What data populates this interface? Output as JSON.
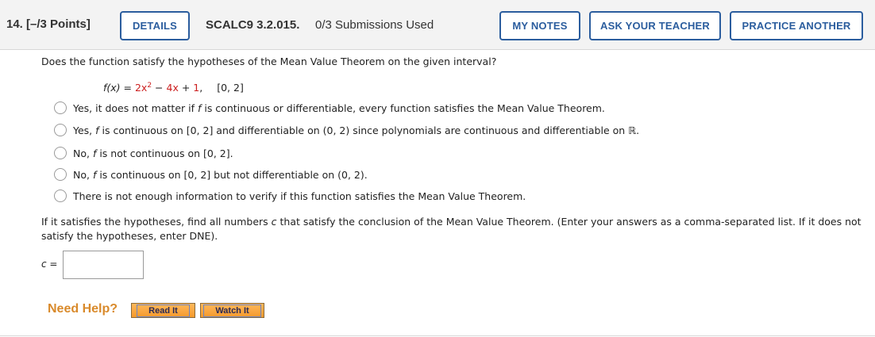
{
  "header": {
    "question_number": "14.",
    "points": "[–/3 Points]",
    "details_label": "DETAILS",
    "problem_code": "SCALC9 3.2.015.",
    "submissions": "0/3 Submissions Used",
    "my_notes_label": "MY NOTES",
    "ask_teacher_label": "ASK YOUR TEACHER",
    "practice_label": "PRACTICE ANOTHER"
  },
  "question": {
    "prompt": "Does the function satisfy the hypotheses of the Mean Value Theorem on the given interval?",
    "function": {
      "lhs": "f(x) = ",
      "coef1": "2x",
      "exp": "2",
      "minus": " − ",
      "term2": "4x",
      "plus": " + ",
      "term3": "1",
      "comma": ",",
      "interval": "[0, 2]"
    },
    "options": [
      {
        "pre": "Yes, it does not matter if ",
        "f": "f",
        "post": " is continuous or differentiable, every function satisfies the Mean Value Theorem."
      },
      {
        "pre": "Yes, ",
        "f": "f",
        "post": " is continuous on [0, 2] and differentiable on (0, 2) since polynomials are continuous and differentiable on ℝ."
      },
      {
        "pre": "No, ",
        "f": "f",
        "post": " is not continuous on [0, 2]."
      },
      {
        "pre": "No, ",
        "f": "f",
        "post": " is continuous on [0, 2] but not differentiable on (0, 2)."
      },
      {
        "pre": "There is not enough information to verify if this function satisfies the Mean Value Theorem.",
        "f": "",
        "post": ""
      }
    ]
  },
  "followup": {
    "line1_pre": "If it satisfies the hypotheses, find all numbers ",
    "line1_c": "c",
    "line1_post": " that satisfy the conclusion of the Mean Value Theorem. (Enter your answers as a comma-separated list. If it does not satisfy the hypotheses, enter DNE).",
    "c_label": "c =",
    "c_value": ""
  },
  "help": {
    "label": "Need Help?",
    "read_it": "Read It",
    "watch_it": "Watch It"
  },
  "colors": {
    "accent": "#2b5d9e",
    "highlight_red": "#cc1f1f",
    "help_orange": "#d98a2b"
  }
}
